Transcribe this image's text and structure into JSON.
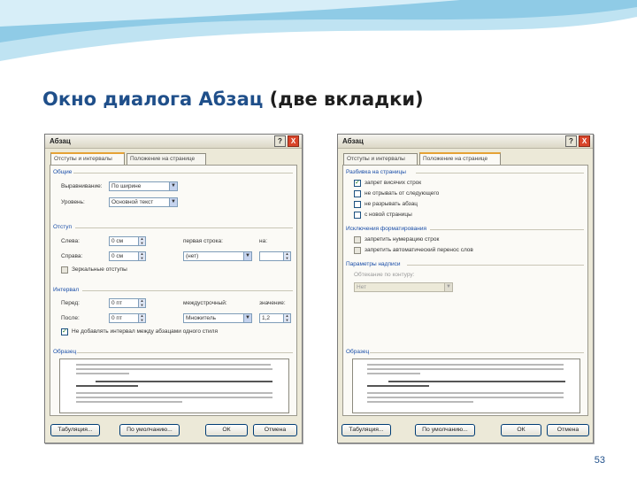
{
  "slide": {
    "title_accent": "Окно диалога Абзац",
    "title_rest": " (две вкладки)",
    "page_number": "53"
  },
  "colors": {
    "title_blue": "#1f4f8a",
    "wave": "#9fd3ea",
    "dialog_bg": "#ece9d8",
    "group_header": "#1a4ea8"
  },
  "dialog_left": {
    "title": "Абзац",
    "help_label": "?",
    "close_label": "X",
    "tabs": [
      "Отступы и интервалы",
      "Положение на странице"
    ],
    "groups": {
      "general": "Общие",
      "indent": "Отступ",
      "spacing": "Интервал",
      "preview": "Образец"
    },
    "labels": {
      "alignment": "Выравнивание:",
      "level": "Уровень:",
      "left": "Слева:",
      "right": "Справа:",
      "first_line": "первая строка:",
      "by": "на:",
      "mirror": "Зеркальные отступы",
      "before": "Перед:",
      "after": "После:",
      "line_spacing": "междустрочный:",
      "value": "значение:",
      "no_space": "Не добавлять интервал между абзацами одного стиля"
    },
    "values": {
      "alignment": "По ширине",
      "level": "Основной текст",
      "left": "0 см",
      "right": "0 см",
      "first_line": "(нет)",
      "by": "",
      "before": "0 пт",
      "after": "0 пт",
      "line_spacing": "Множитель",
      "value": "1,2"
    },
    "buttons": [
      "Табуляция...",
      "По умолчанию...",
      "ОК",
      "Отмена"
    ]
  },
  "dialog_right": {
    "title": "Абзац",
    "help_label": "?",
    "close_label": "X",
    "tabs": [
      "Отступы и интервалы",
      "Положение на странице"
    ],
    "groups": {
      "pagination": "Разбивка на страницы",
      "exceptions": "Исключения форматирования",
      "textbox": "Параметры надписи",
      "preview": "Образец"
    },
    "checkboxes": [
      {
        "label": "запрет висячих строк",
        "checked": true,
        "dim": false
      },
      {
        "label": "не отрывать от следующего",
        "checked": false,
        "dim": false
      },
      {
        "label": "не разрывать абзац",
        "checked": false,
        "dim": false
      },
      {
        "label": "с новой страницы",
        "checked": false,
        "dim": false
      },
      {
        "label": "запретить нумерацию строк",
        "checked": false,
        "dim": true
      },
      {
        "label": "запретить автоматический перенос слов",
        "checked": false,
        "dim": true
      }
    ],
    "wrap_label": "Обтекание по контуру:",
    "wrap_value": "Нет",
    "buttons": [
      "Табуляция...",
      "По умолчанию...",
      "ОК",
      "Отмена"
    ]
  }
}
